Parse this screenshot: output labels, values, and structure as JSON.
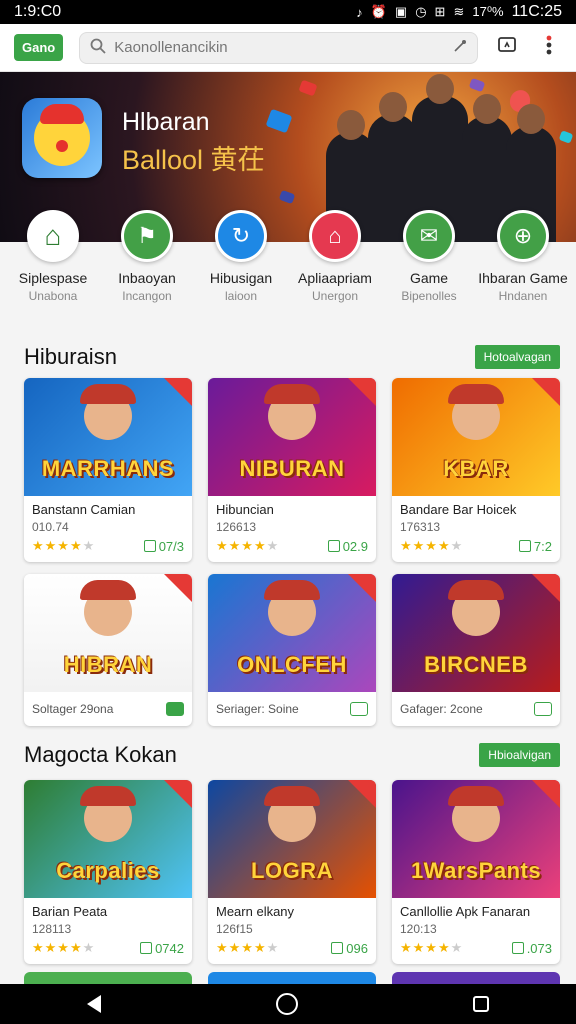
{
  "status_bar": {
    "time": "1:9:C0",
    "icons": [
      "♪",
      "⏰",
      "▣",
      "◷",
      "⊞",
      "≋"
    ],
    "battery": "17⁰%",
    "clock": "11C:25"
  },
  "app_bar": {
    "logo": "Gano",
    "search_placeholder": "Kaonollenancikin"
  },
  "hero": {
    "title": "Hlbaran",
    "subtitle": "Ballool 黄茌"
  },
  "categories": [
    {
      "label": "Siplespase",
      "sub": "Unabona",
      "color": "#2e7d32",
      "icon": "⌂"
    },
    {
      "label": "Inbaoyan",
      "sub": "Incangon",
      "color": "#43a047",
      "icon": "⚑"
    },
    {
      "label": "Hibusigan",
      "sub": "laioon",
      "color": "#1e88e5",
      "icon": "↻"
    },
    {
      "label": "Apliaapriam",
      "sub": "Unergon",
      "color": "#e53950",
      "icon": "⌂"
    },
    {
      "label": "Game",
      "sub": "Bipenolles",
      "color": "#43a047",
      "icon": "✉"
    },
    {
      "label": "Ihbaran Game",
      "sub": "Hndanen",
      "color": "#43a047",
      "icon": "⊕"
    }
  ],
  "section1": {
    "title": "Hiburaisn",
    "see_all": "Hotoalvagan",
    "cards": [
      {
        "art": "MARRHANS",
        "name": "Banstann Camian",
        "code": "010.74",
        "rating": 4,
        "downloads": "07/3",
        "bg": "linear-gradient(135deg,#1565c0,#42a5f5)"
      },
      {
        "art": "NIBURAN",
        "name": "Hibuncian",
        "code": "126613",
        "rating": 4,
        "downloads": "02.9",
        "bg": "linear-gradient(135deg,#6a1b9a,#d81b60)"
      },
      {
        "art": "KBAR",
        "name": "Bandare Bar Hoicek",
        "code": "176313",
        "rating": 4,
        "downloads": "7:2",
        "bg": "linear-gradient(135deg,#ef6c00,#ffca28)"
      }
    ],
    "cards2": [
      {
        "art": "HIBRAN",
        "footer": "Soltager 29ona",
        "filled": true,
        "bg": "linear-gradient(180deg,#ffffff,#f2f2f2)"
      },
      {
        "art": "ONLCFEH",
        "footer": "Seriager: Soine",
        "filled": false,
        "bg": "linear-gradient(135deg,#1976d2,#ab47bc)"
      },
      {
        "art": "BIRCNEB",
        "footer": "Gafager: 2cone",
        "filled": false,
        "bg": "linear-gradient(135deg,#311b92,#b71c1c)"
      }
    ]
  },
  "section2": {
    "title": "Magocta Kokan",
    "see_all": "Hbioalvigan",
    "cards": [
      {
        "art": "Carpalies",
        "name": "Barian Peata",
        "code": "128113",
        "rating": 4,
        "downloads": "0742",
        "bg": "linear-gradient(135deg,#2e7d32,#4fc3f7)"
      },
      {
        "art": "LOGRA",
        "name": "Mearn elkany",
        "code": "126f15",
        "rating": 4,
        "downloads": "096",
        "bg": "linear-gradient(135deg,#0d47a1,#e65100)"
      },
      {
        "art": "1WarsPants",
        "name": "Canllollie Apk Fanaran",
        "code": "120:13",
        "rating": 4,
        "downloads": ".073",
        "bg": "linear-gradient(135deg,#4a148c,#ec407a)"
      }
    ]
  }
}
